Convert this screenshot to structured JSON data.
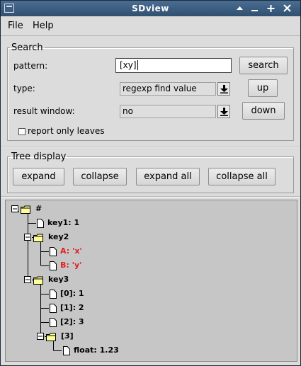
{
  "window": {
    "title": "SDview"
  },
  "menu": {
    "file": "File",
    "help": "Help"
  },
  "search": {
    "legend": "Search",
    "pattern_label": "pattern:",
    "pattern_value": "[xy]",
    "type_label": "type:",
    "type_value": "regexp find value",
    "result_label": "result window:",
    "result_value": "no",
    "only_leaves_label": "report only leaves",
    "only_leaves_checked": false,
    "search_btn": "search",
    "up_btn": "up",
    "down_btn": "down"
  },
  "tree_display": {
    "legend": "Tree display",
    "expand": "expand",
    "collapse": "collapse",
    "expand_all": "expand all",
    "collapse_all": "collapse all"
  },
  "tree": {
    "root": "#",
    "key1": "key1: 1",
    "key2": "key2",
    "key2_a": "A: 'x'",
    "key2_b": "B: 'y'",
    "key3": "key3",
    "key3_0": "[0]: 1",
    "key3_1": "[1]: 2",
    "key3_2": "[2]: 3",
    "key3_3": "[3]",
    "float": "float: 1.23",
    "highlight_color": "#e02020"
  }
}
